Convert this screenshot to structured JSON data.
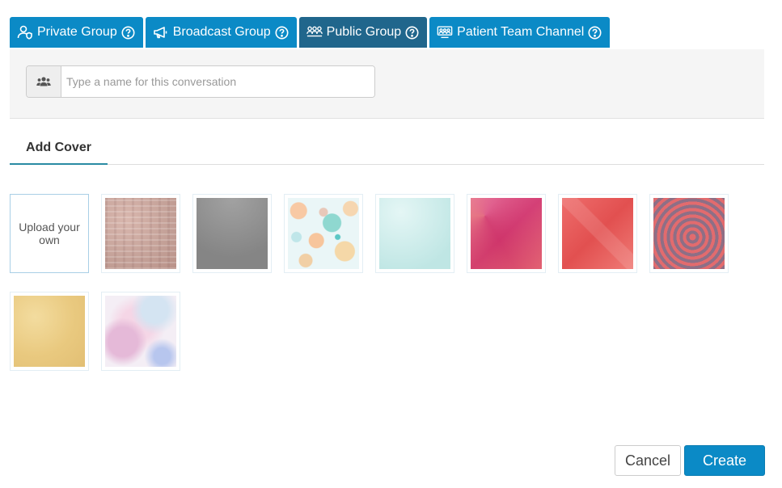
{
  "tabs": [
    {
      "label": "Private Group",
      "icon": "private-group-icon",
      "active": false
    },
    {
      "label": "Broadcast Group",
      "icon": "megaphone-icon",
      "active": false
    },
    {
      "label": "Public Group",
      "icon": "public-group-icon",
      "active": true
    },
    {
      "label": "Patient Team Channel",
      "icon": "team-channel-icon",
      "active": false
    }
  ],
  "name_field": {
    "placeholder": "Type a name for this conversation",
    "value": "",
    "addon_icon": "users-icon"
  },
  "section": {
    "tab_label": "Add Cover"
  },
  "covers": {
    "upload_label": "Upload your own",
    "items": [
      "pink-brick",
      "gray-gradient",
      "pastel-circles",
      "mint-gradient",
      "pink-hexagons",
      "red-geometric",
      "red-spiral",
      "gold-foil",
      "pastel-watercolor"
    ]
  },
  "buttons": {
    "cancel": "Cancel",
    "create": "Create"
  },
  "colors": {
    "tab": "#0b8ac6",
    "tab_active": "#20668c",
    "accent": "#2a8ba3",
    "panel": "#f5f5f5"
  }
}
